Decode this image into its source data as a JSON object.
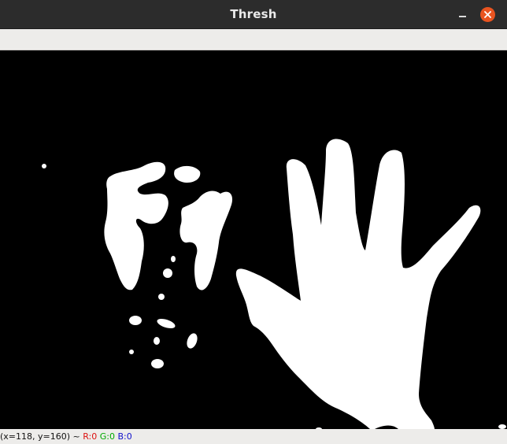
{
  "window": {
    "title": "Thresh"
  },
  "status": {
    "coords": "(x=118, y=160) ~",
    "r": "R:0",
    "g": "G:0",
    "b": "B:0"
  },
  "colors": {
    "titlebar": "#2c2c2c",
    "close_button": "#e95420",
    "foreground": "#ffffff",
    "background": "#000000",
    "r_label": "#d11111",
    "g_label": "#00aa00",
    "b_label": "#1111cc"
  },
  "icons": {
    "minimize": "minimize-icon",
    "close": "close-icon"
  }
}
